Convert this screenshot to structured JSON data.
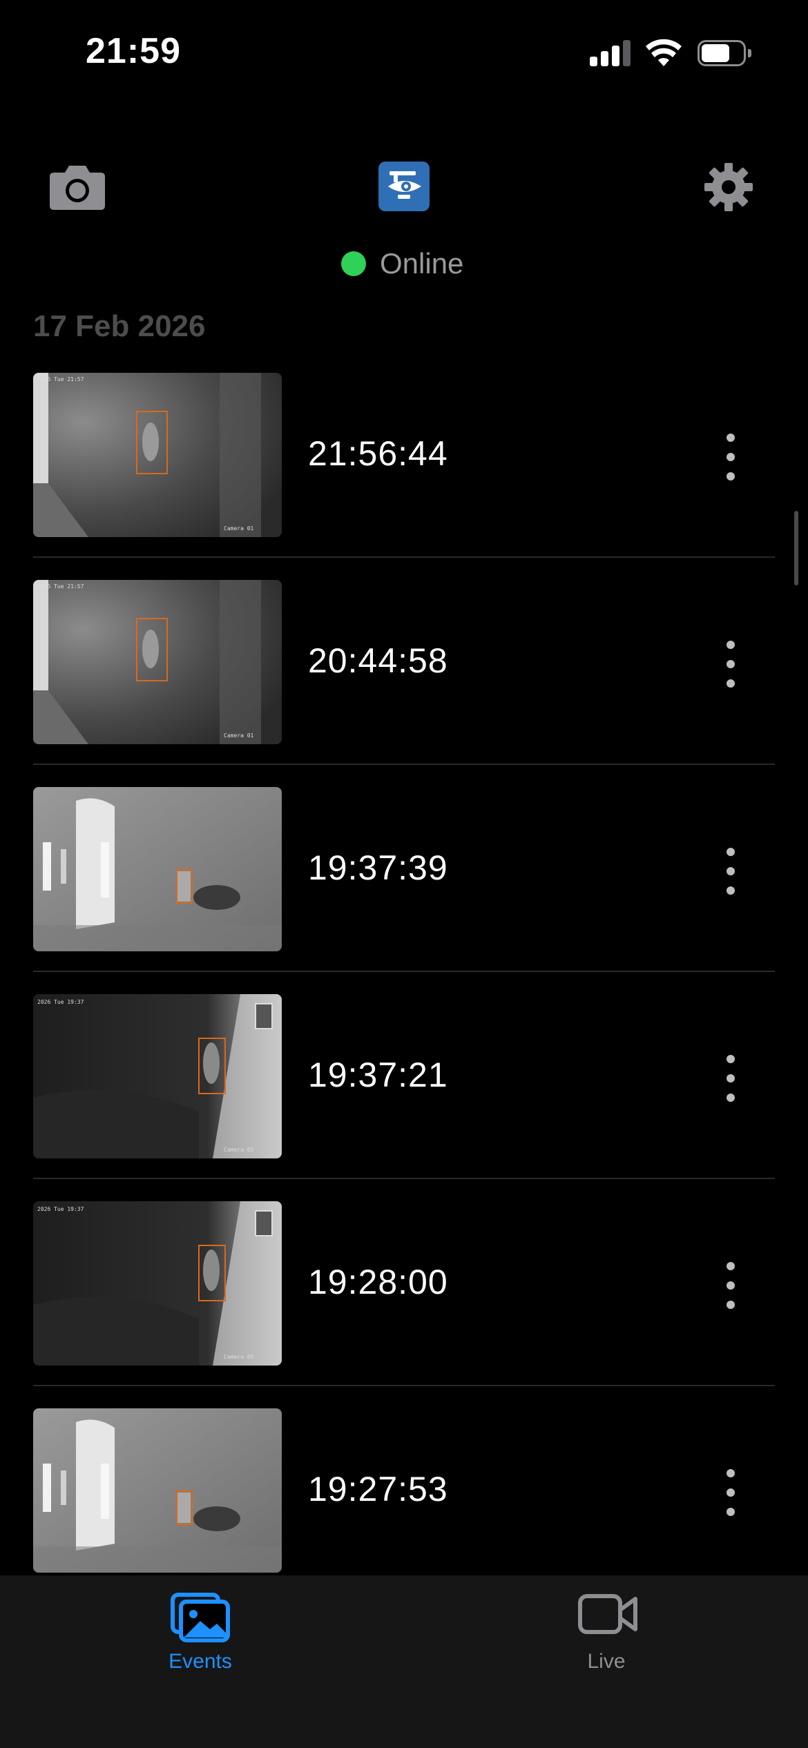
{
  "status_bar": {
    "time": "21:59"
  },
  "header": {
    "status_text": "Online",
    "status_color": "#30d158"
  },
  "colors": {
    "accent": "#1e90ff",
    "inactive": "#8e8e93",
    "logo_bg": "#2f6fb5"
  },
  "section": {
    "date": "17 Feb 2026"
  },
  "events": [
    {
      "time": "21:56:44",
      "camera": "Camera 01",
      "scene": "driveway-night"
    },
    {
      "time": "20:44:58",
      "camera": "Camera 01",
      "scene": "driveway-night"
    },
    {
      "time": "19:37:39",
      "camera": "",
      "scene": "house-front"
    },
    {
      "time": "19:37:21",
      "camera": "Camera 05",
      "scene": "side-dark"
    },
    {
      "time": "19:28:00",
      "camera": "Camera 05",
      "scene": "side-dark"
    },
    {
      "time": "19:27:53",
      "camera": "",
      "scene": "house-front"
    }
  ],
  "tabs": [
    {
      "label": "Events",
      "icon": "photos-icon",
      "active": true
    },
    {
      "label": "Live",
      "icon": "video-camera-icon",
      "active": false
    }
  ]
}
